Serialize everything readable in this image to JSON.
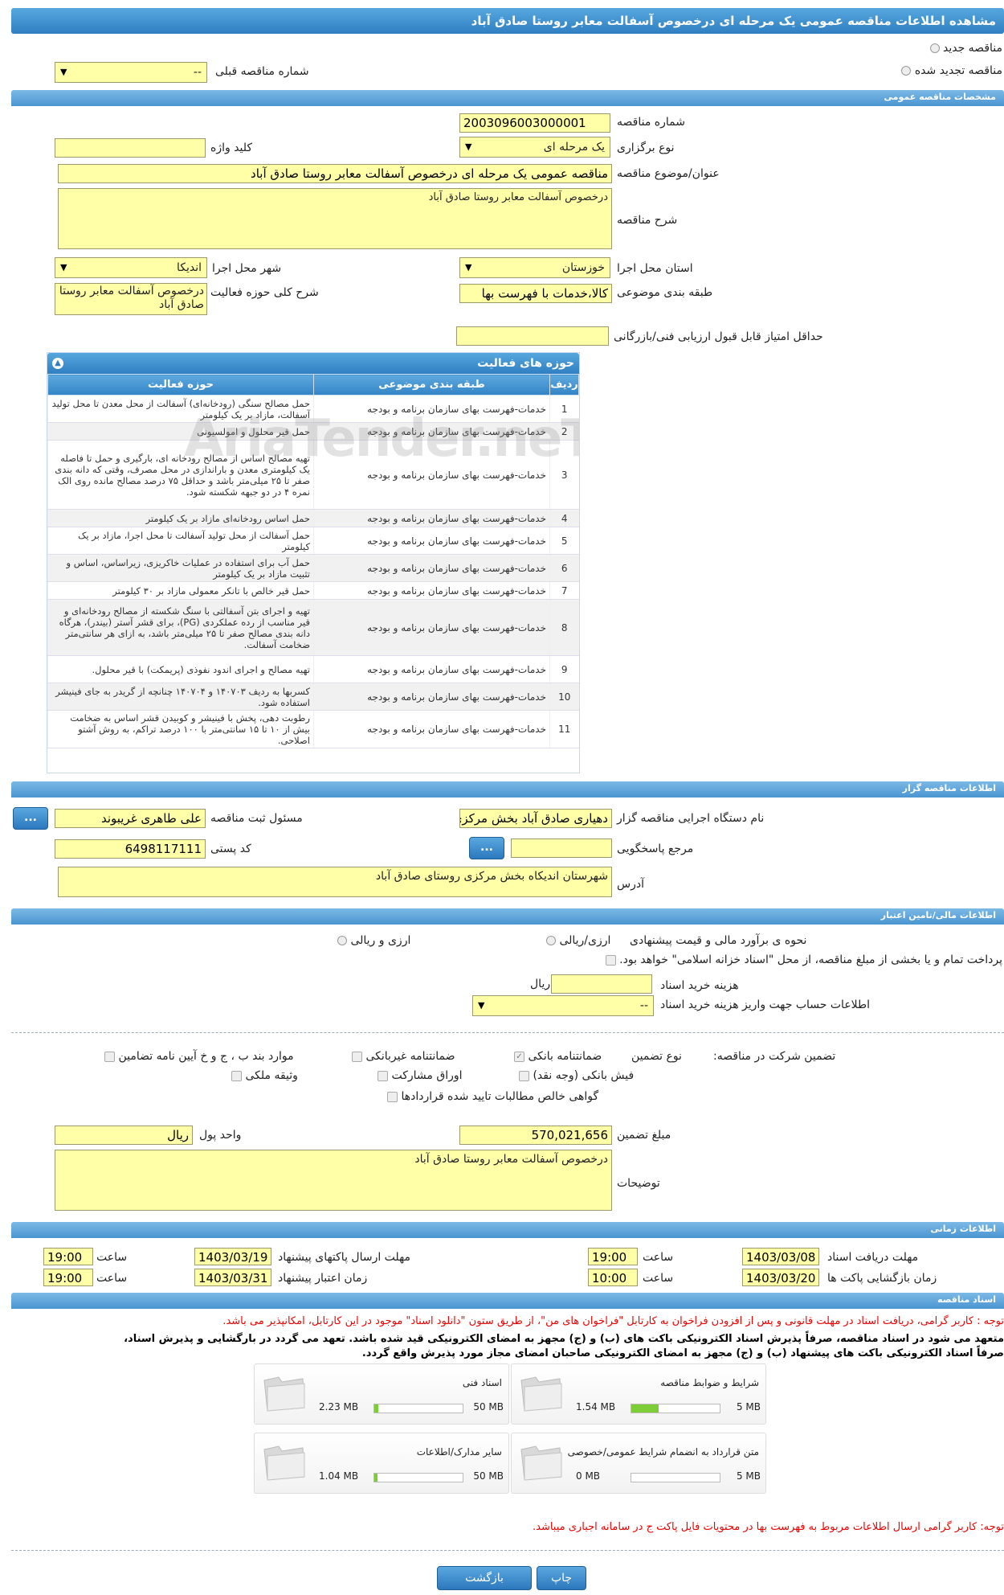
{
  "page_title": "مشاهده اطلاعات مناقصه عمومی یک مرحله ای درخصوص آسفالت معابر روستا صادق آباد",
  "top": {
    "radio_new": "مناقصه جدید",
    "radio_renewed": "مناقصه تجدید شده",
    "prev_label": "شماره مناقصه قبلی",
    "prev_value": "--"
  },
  "general": {
    "title": "مشخصات مناقصه عمومی",
    "number_label": "شماره مناقصه",
    "number_value": "2003096003000001",
    "type_label": "نوع برگزاری",
    "type_value": "یک مرحله ای",
    "keyword_label": "کلید واژه",
    "keyword_value": "",
    "subject_label": "عنوان/موضوع مناقصه",
    "subject_value": "مناقصه عمومی یک مرحله ای درخصوص آسفالت معابر روستا صادق آباد",
    "desc_label": "شرح مناقصه",
    "desc_value": "درخصوص آسفالت معابر روستا صادق آباد",
    "province_label": "استان محل اجرا",
    "province_value": "خوزستان",
    "city_label": "شهر محل اجرا",
    "city_value": "اندیکا",
    "category_label": "طبقه بندی موضوعی",
    "category_value": "کالا،خدمات با فهرست بها",
    "scope_label": "شرح کلی حوزه فعالیت",
    "scope_value": "درخصوص آسفالت معابر روستا صادق آباد",
    "min_score_label": "حداقل امتیاز قابل قبول ارزیابی فنی/بازرگانی",
    "min_score_value": ""
  },
  "activities": {
    "title": "حوزه های فعالیت",
    "col_row": "ردیف",
    "col_category": "طبقه بندی موضوعی",
    "col_scope": "حوزه فعالیت",
    "rows": [
      {
        "n": "1",
        "cat": "خدمات-فهرست بهای سازمان برنامه و بودجه",
        "scope": "حمل مصالح سنگی (رودخانه‌ای) آسفالت از محل معدن تا محل تولید آسفالت، مازاد بر یک کیلومتر"
      },
      {
        "n": "2",
        "cat": "خدمات-فهرست بهای سازمان برنامه و بودجه",
        "scope": "حمل قیر محلول و امولسیونی"
      },
      {
        "n": "3",
        "cat": "خدمات-فهرست بهای سازمان برنامه و بودجه",
        "scope": "تهیه مصالح اساس از مصالح رودخانه ای، بارگیری و حمل تا فاصله یک کیلومتری معدن و باراندازی در محل مصرف، وقتی که دانه بندی صفر تا ۲۵ میلی‌متر باشد و حداقل ۷۵ درصد مصالح مانده روی الک نمره ۴ در دو جبهه شکسته شود."
      },
      {
        "n": "4",
        "cat": "خدمات-فهرست بهای سازمان برنامه و بودجه",
        "scope": "حمل اساس رودخانه‌ای مازاد بر یک کیلومتر"
      },
      {
        "n": "5",
        "cat": "خدمات-فهرست بهای سازمان برنامه و بودجه",
        "scope": "حمل آسفالت از محل تولید آسفالت تا محل اجرا، مازاد بر یک کیلومتر"
      },
      {
        "n": "6",
        "cat": "خدمات-فهرست بهای سازمان برنامه و بودجه",
        "scope": "حمل آب برای استفاده در عملیات خاکریزی، زیراساس، اساس و تثبیت مازاد بر یک کیلومتر"
      },
      {
        "n": "7",
        "cat": "خدمات-فهرست بهای سازمان برنامه و بودجه",
        "scope": "حمل قیر خالص با تانکر معمولی مازاد بر ۳۰ کیلومتر"
      },
      {
        "n": "8",
        "cat": "خدمات-فهرست بهای سازمان برنامه و بودجه",
        "scope": "تهیه و اجرای بتن آسفالتی با سنگ شکسته از مصالح رودخانه‌ای و قیر مناسب از رده عملکردی (PG)، برای قشر آستر (بیندر)، هرگاه دانه بندی مصالح صفر تا ۲۵ میلی‌متر باشد، به ازای هر سانتی‌متر ضخامت آسفالت."
      },
      {
        "n": "9",
        "cat": "خدمات-فهرست بهای سازمان برنامه و بودجه",
        "scope": "تهیه مصالح و اجرای اندود نفوذی (پریمکت) با قیر محلول."
      },
      {
        "n": "10",
        "cat": "خدمات-فهرست بهای سازمان برنامه و بودجه",
        "scope": "کسربها به ردیف ۱۴۰۷۰۳ و ۱۴۰۷۰۴ چنانچه از گریدر به جای فینیشر استفاده شود."
      },
      {
        "n": "11",
        "cat": "خدمات-فهرست بهای سازمان برنامه و بودجه",
        "scope": "رطوبت دهی، پخش با فینیشر و کوبیدن قشر اساس به ضخامت بیش از ۱۰ تا ۱۵ سانتی‌متر با ۱۰۰ درصد تراکم، به روش آشتو اصلاحی."
      }
    ]
  },
  "organizer": {
    "title": "اطلاعات مناقصه گزار",
    "org_label": "نام دستگاه اجرایی مناقصه گزار",
    "org_value": "دهیاری صادق آباد بخش مرکزی",
    "resp_label": "مسئول ثبت مناقصه",
    "resp_value": "علی طاهری غریبوند",
    "ref_label": "مرجع پاسخگویی",
    "ref_value": "",
    "postal_label": "کد پستی",
    "postal_value": "6498117111",
    "addr_label": "آدرس",
    "addr_value": "شهرستان اندیکاه بخش مرکزی  روستای صادق آباد",
    "dots": "..."
  },
  "financial": {
    "title": "اطلاعات مالی/تامین اعتبار",
    "estimate_label": "نحوه ی برآورد مالی و قیمت پیشنهادی",
    "opt1": "ارزی/ریالی",
    "opt2": "ارزی و ریالی",
    "payment_text": "پرداخت تمام و یا بخشی از مبلغ مناقصه، از محل \"اسناد خزانه اسلامی\" خواهد بود.",
    "doc_fee_label": "هزینه خرید اسناد",
    "doc_fee_unit": "ریال",
    "doc_fee_value": "",
    "account_label": "اطلاعات حساب جهت واریز هزینه خرید اسناد",
    "account_value": "--",
    "guarantee_label": "تضمین شرکت در مناقصه:",
    "guarantee_type": "نوع تضمین",
    "g_bank": "ضمانتنامه بانکی",
    "g_nonbank": "ضمانتنامه غیربانکی",
    "g_items": "موارد بند ب ، ج و خ آیین نامه تضامین",
    "g_cheque": "فیش بانکی (وجه نقد)",
    "g_bonds": "اوراق مشارکت",
    "g_property": "وثیقه ملکی",
    "g_claims": "گواهی خالص مطالبات تایید شده قراردادها",
    "amount_label": "مبلغ تضمین",
    "amount_value": "570,021,656",
    "currency_label": "واحد پول",
    "currency_value": "ریال",
    "notes_label": "توضیحات",
    "notes_value": "درخصوص  آسفالت معابر روستا صادق آباد"
  },
  "timing": {
    "title": "اطلاعات زمانی",
    "doc_receive_label": "مهلت دریافت اسناد",
    "doc_receive_date": "1403/03/08",
    "doc_receive_time": "19:00",
    "submit_label": "مهلت ارسال پاکتهای پیشنهاد",
    "submit_date": "1403/03/19",
    "submit_time": "19:00",
    "open_label": "زمان بازگشایی پاکت ها",
    "open_date": "1403/03/20",
    "open_time": "10:00",
    "validity_label": "زمان اعتبار پیشنهاد",
    "validity_date": "1403/03/31",
    "validity_time": "19:00",
    "time_label": "ساعت"
  },
  "documents": {
    "title": "اسناد مناقصه",
    "note1": "توجه : کاربر گرامی، دریافت اسناد در مهلت قانونی و پس از افزودن فراخوان به کارتابل \"فراخوان های من\"، از طریق ستون \"دانلود اسناد\" موجود در این کارتابل، امکانپذیر می باشد.",
    "note2": "متعهد می شود در اسناد مناقصه، صرفاً پذیرش اسناد الکترونیکی باکت های (ب) و (ج) مجهز به امضای الکترونیکی قید شده باشد. تعهد می گردد در بارگشایی و پذیرش اسناد،",
    "note3": "صرفاً اسناد الکترونیکی باکت های پیشنهاد (ب) و (ج) مجهز به امضای الکترونیکی صاحبان امضای مجاز مورد پذیرش واقع گردد.",
    "files": [
      {
        "name": "شرایط و ضوابط مناقصه",
        "max": "5 MB",
        "used": "1.54 MB",
        "ratio": 0.31
      },
      {
        "name": "اسناد فنی",
        "max": "50 MB",
        "used": "2.23 MB",
        "ratio": 0.045
      },
      {
        "name": "متن قرارداد به انضمام شرایط عمومی/خصوصی",
        "max": "5 MB",
        "used": "0 MB",
        "ratio": 0
      },
      {
        "name": "سایر مدارک/اطلاعات",
        "max": "50 MB",
        "used": "1.04 MB",
        "ratio": 0.021
      }
    ],
    "note4": "توجه: کاربر گرامی ارسال اطلاعات مربوط به فهرست بها در محتویات فایل پاکت ج در سامانه اجباری میباشد."
  },
  "buttons": {
    "print": "چاپ",
    "back": "بازگشت"
  },
  "watermark": "AriaTender.neT"
}
